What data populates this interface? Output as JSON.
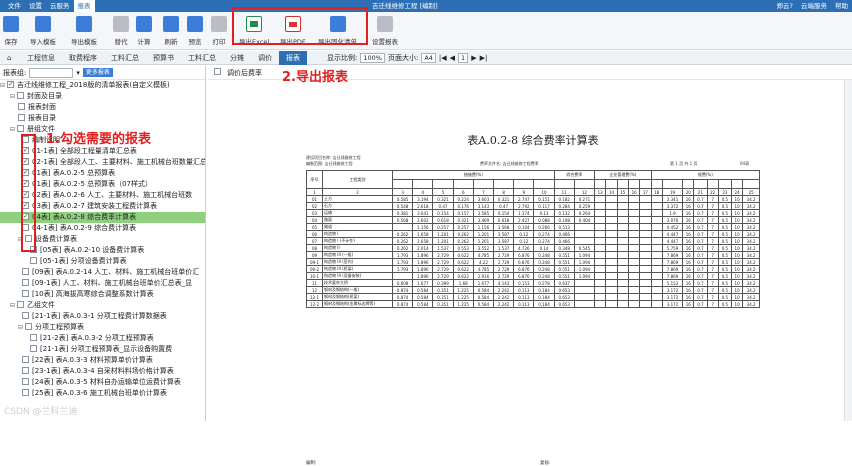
{
  "titlebar": {
    "menus": [
      "文件",
      "设置",
      "云服务",
      "报表"
    ],
    "window_title": "吉迁线维修工程 [编制]",
    "right": [
      "郑云?",
      "云端服务",
      "帮助"
    ]
  },
  "ribbon": {
    "buttons": [
      "保存",
      "导入模板",
      "导出模板",
      "替代",
      "计算",
      "刷新",
      "预览",
      "打印",
      "导出Excel",
      "导出PDF",
      "导出固化清单",
      "设置报表"
    ]
  },
  "tabs": [
    "工程信息",
    "取费程序",
    "工料汇总",
    "预算书",
    "工料汇总",
    "分摊",
    "调价",
    "报表"
  ],
  "active_tab": "报表",
  "view": {
    "zoom_label": "显示比例:",
    "zoom": "100%",
    "page_size_label": "页面大小:",
    "page_size": "A4",
    "page": "1"
  },
  "leftpanel": {
    "filter_label": "报表组:",
    "btn_more": "更多报表",
    "root": "吉迁线维修工程_2018版的清单报表(自定义模板)",
    "rows": [
      "封面及目录",
      "报表封面",
      "报表目录",
      "册组文件",
      "编制说明",
      "01-1表] 全部段工程量清单汇总表",
      "02-1表] 全部段人工、主要材料、施工机械台班数量汇总",
      "01表] 表A.0.2-5 总预算表",
      "01表] 表A.0.2-5 总预算表（07样式）",
      "02表] 表A.0.2-6 人工、主要材料、施工机械台班数",
      "03表] 表A.0.2-7 建筑安装工程费计算表",
      "04表] 表A.0.2-8 综合费率计算表",
      "04-1表] 表A.0.2-9 综合费计算表",
      "设备费计算表",
      "[05表] 表A.0.2-10 设备费计算表",
      "[05-1表] 分项设备费计算表",
      "[09表] 表A.0.2-14 人工、材料、施工机械台班单价汇",
      "[09-1表] 人工、材料、施工机械台班单价汇总表_显",
      "[10表] 高海拔高寒综合调整系数计算表",
      "乙组文件",
      "[21-1表] 表A.0.3-1 分项工程费计算数据表",
      "分项工程预算表",
      "[21-2表] 表A.0.3-2 分项工程预算表",
      "[21-1表] 分项工程预算表_显示设备购置费",
      "[22表] 表A.0.3-3 材料预算单价计算表",
      "[23-1表] 表A.0.3-4 自采材料料场价格计算表",
      "[24表] 表A.0.3-5 材料自办运输单位运费计算表",
      "[25表] 表A.0.3-6 施工机械台班单价计算表"
    ]
  },
  "annotations": {
    "a1": "1.勾选需要的报表",
    "a2": "2.导出报表"
  },
  "viewer": {
    "checkbox_label": "调价后费率"
  },
  "report": {
    "title": "表A.0.2-8 综合费率计算表",
    "meta_left1": "建设项目名称: 吉迁线维修工程",
    "meta_left2": "编制范围: 吉迁线维修工程",
    "meta_mid": "费率文件名: 吉迁线维修工程费率",
    "meta_right": "第 1 页   共 1 页",
    "meta_code": "04表",
    "header": [
      "序号",
      "工程类别",
      "措施费(%)",
      "综合费率",
      "企业管理费(%)",
      "规费(%)"
    ],
    "colnums": [
      "1",
      "2",
      "3",
      "4",
      "5",
      "6",
      "7",
      "8",
      "9",
      "10",
      "11",
      "12",
      "13",
      "14",
      "15",
      "16",
      "17",
      "18",
      "19",
      "20",
      "21",
      "22",
      "23",
      "24",
      "25"
    ],
    "rows": [
      [
        "01",
        "土方",
        "0.585",
        "3.194",
        "0.321",
        "0.224",
        "3.603",
        "0.321",
        "2.747",
        "0.151",
        "0.182",
        "0.271",
        "3.341",
        "16",
        "0.7",
        "7",
        "0.5",
        "10",
        "34.2"
      ],
      [
        "02",
        "石方",
        "0.548",
        "2.618",
        "0.47",
        "0.176",
        "3.143",
        "0.47",
        "2.792",
        "0.117",
        "0.284",
        "0.259",
        "3.372",
        "16",
        "0.7",
        "7",
        "0.5",
        "10",
        "34.2"
      ],
      [
        "03",
        "运输",
        "0.381",
        "3.041",
        "0.154",
        "0.157",
        "3.585",
        "0.154",
        "1.374",
        "0.13",
        "0.132",
        "0.264",
        "1.9",
        "16",
        "0.7",
        "7",
        "0.5",
        "10",
        "34.2"
      ],
      [
        "04",
        "路面",
        "0.568",
        "2.602",
        "0.618",
        "0.321",
        "3.469",
        "0.618",
        "2.427",
        "0.088",
        "0.198",
        "0.404",
        "3.076",
        "16",
        "0.7",
        "7",
        "0.5",
        "10",
        "34.2"
      ],
      [
        "05",
        "隧道",
        "",
        "1.156",
        "0.257",
        "0.257",
        "1.156",
        "3.568",
        "0.104",
        "0.266",
        "0.513",
        "4.452",
        "16",
        "0.7",
        "7",
        "0.5",
        "10",
        "34.2"
      ],
      [
        "06",
        "构造物 I",
        "0.262",
        "1.658",
        "1.201",
        "0.262",
        "1.201",
        "3.587",
        "0.12",
        "0.274",
        "0.466",
        "4.447",
        "16",
        "0.7",
        "7",
        "0.5",
        "10",
        "34.2"
      ],
      [
        "07",
        "构造物 I (不计冬)",
        "0.262",
        "1.658",
        "1.201",
        "0.262",
        "1.201",
        "3.587",
        "0.12",
        "0.274",
        "0.466",
        "4.447",
        "16",
        "0.7",
        "7",
        "0.5",
        "10",
        "34.2"
      ],
      [
        "08",
        "构造物 II",
        "0.262",
        "2.014",
        "1.537",
        "0.553",
        "3.552",
        "1.537",
        "4.726",
        "0.14",
        "0.348",
        "0.545",
        "5.759",
        "16",
        "0.7",
        "7",
        "0.5",
        "10",
        "34.2"
      ],
      [
        "09",
        "构造物 III (一般)",
        "1.793",
        "1.896",
        "2.729",
        "0.622",
        "4.785",
        "2.729",
        "6.876",
        "0.248",
        "0.551",
        "1.094",
        "7.869",
        "16",
        "0.7",
        "7",
        "0.5",
        "10",
        "34.2"
      ],
      [
        "09-1",
        "构造物 III (室内)",
        "1.793",
        "1.896",
        "2.729",
        "0.622",
        "4.22",
        "2.729",
        "6.876",
        "0.248",
        "0.551",
        "1.094",
        "7.869",
        "16",
        "0.7",
        "7",
        "0.5",
        "10",
        "34.2"
      ],
      [
        "09-2",
        "构造物 III (桥梁)",
        "1.793",
        "1.896",
        "2.729",
        "0.622",
        "4.785",
        "2.729",
        "6.876",
        "0.248",
        "0.551",
        "1.094",
        "7.869",
        "16",
        "0.7",
        "7",
        "0.5",
        "10",
        "34.2"
      ],
      [
        "10-1",
        "构造物 III (设备安装)",
        "",
        "1.896",
        "2.729",
        "0.622",
        "2.916",
        "2.729",
        "6.876",
        "0.248",
        "0.551",
        "1.094",
        "7.869",
        "16",
        "0.7",
        "7",
        "0.5",
        "10",
        "34.2"
      ],
      [
        "11",
        "技术复杂大桥",
        "0.608",
        "1.677",
        "0.399",
        "1.68",
        "1.677",
        "4.143",
        "0.153",
        "0.278",
        "0.637",
        "5.153",
        "16",
        "0.7",
        "7",
        "0.5",
        "10",
        "34.2"
      ],
      [
        "12",
        "钢材及钢结构(一般)",
        "0.874",
        "0.584",
        "0.351",
        "1.225",
        "0.584",
        "2.242",
        "0.113",
        "0.184",
        "0.653",
        "3.172",
        "16",
        "0.7",
        "7",
        "0.5",
        "10",
        "34.2"
      ],
      [
        "12-1",
        "钢材及钢结构(桥梁)",
        "0.874",
        "0.584",
        "0.351",
        "1.225",
        "0.584",
        "2.242",
        "0.113",
        "0.184",
        "0.653",
        "3.172",
        "16",
        "0.7",
        "7",
        "0.5",
        "10",
        "34.2"
      ],
      [
        "12-2",
        "钢材及钢结构(金属标志牌等)",
        "0.874",
        "0.584",
        "0.351",
        "1.225",
        "0.584",
        "2.242",
        "0.113",
        "0.184",
        "0.653",
        "3.172",
        "16",
        "0.7",
        "7",
        "0.5",
        "10",
        "34.2"
      ]
    ],
    "footer_left": "编制:",
    "footer_right": "复核:"
  },
  "watermark": "CSDN @兰科兰迪"
}
